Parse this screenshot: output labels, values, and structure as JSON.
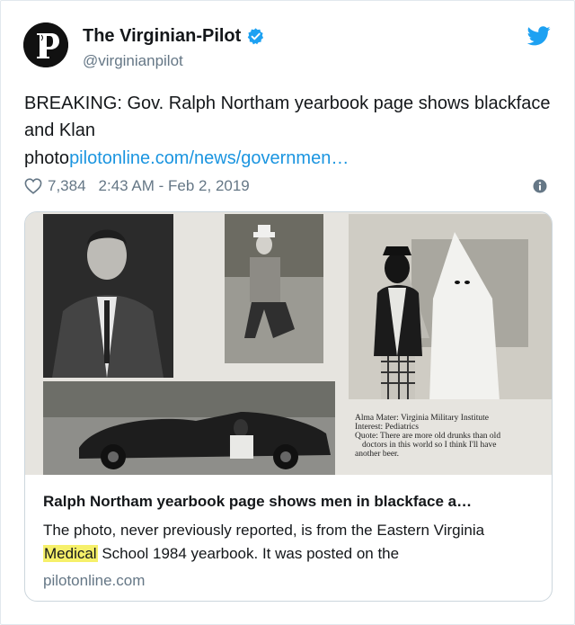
{
  "author": {
    "name": "The Virginian-Pilot",
    "handle": "@virginianpilot",
    "verified": true,
    "avatar_icon": "virginian-pilot-p-logo-icon"
  },
  "tweet": {
    "text": "BREAKING: Gov. Ralph Northam yearbook page shows blackface and Klan",
    "link_prefix": "photo",
    "link_text": "pilotonline.com/news/governmen…",
    "likes": "7,384",
    "timestamp": "2:43 AM - Feb 2, 2019"
  },
  "card": {
    "image_caption": {
      "line1": "Alma Mater: Virginia Military Institute",
      "line2": "Interest: Pediatrics",
      "line3": "Quote: There are more old drunks than old",
      "line4": "doctors in this world so I think I'll have",
      "line5": "another beer."
    },
    "title": "Ralph Northam yearbook page shows men in blackface a…",
    "description_before": "The photo, never previously reported, is from the Eastern Virginia ",
    "description_highlight": "Medical",
    "description_after": " School 1984 yearbook. It was posted on the",
    "domain": "pilotonline.com"
  },
  "icons": {
    "twitter": "twitter-bird-icon",
    "like": "heart-icon",
    "info": "info-icon",
    "verified": "verified-badge-icon"
  },
  "colors": {
    "link": "#1b95e0",
    "verified": "#1da1f2",
    "secondary_text": "#657786",
    "highlight": "#f6f06a"
  }
}
